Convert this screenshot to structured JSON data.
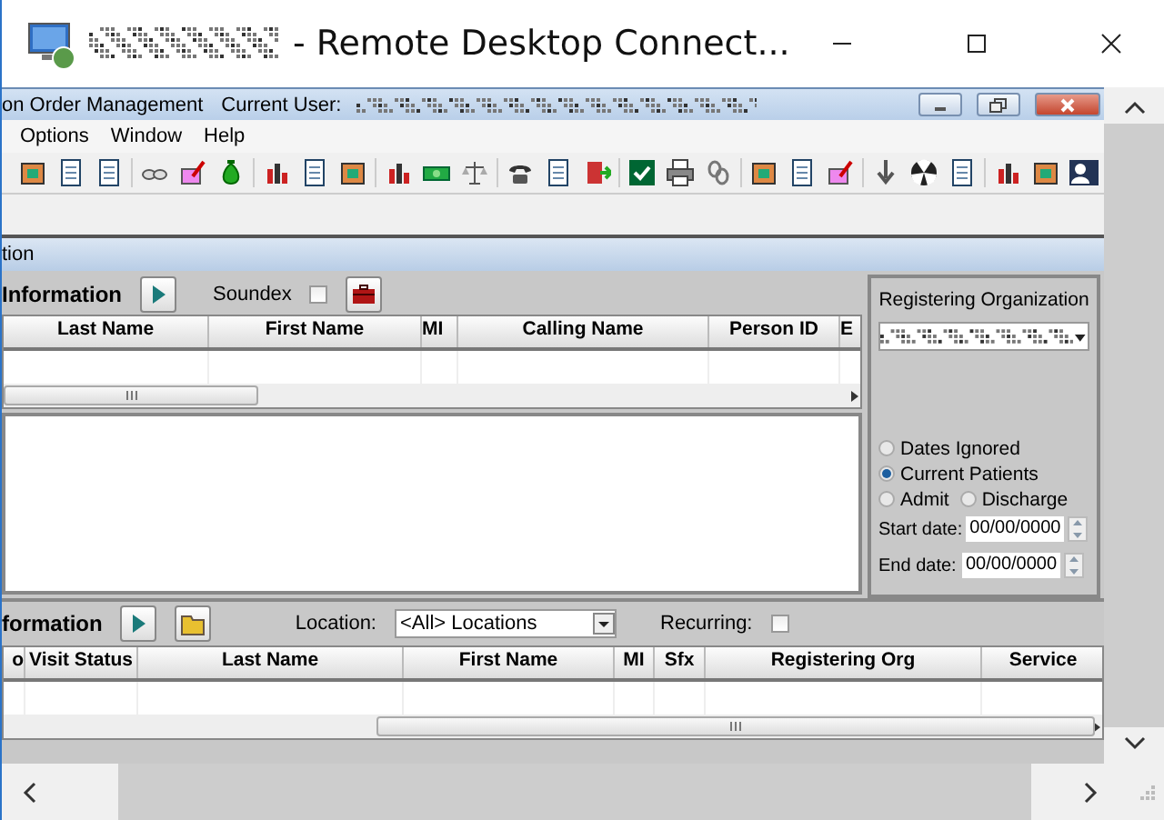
{
  "window": {
    "title": "- Remote Desktop Connect..."
  },
  "app": {
    "title": "on Order Management",
    "user_label": "Current User:"
  },
  "menu": [
    "Options",
    "Window",
    "Help"
  ],
  "toolbar": [
    {
      "kind": "box"
    },
    {
      "kind": "document"
    },
    {
      "kind": "document"
    },
    {
      "kind": "glasses"
    },
    {
      "kind": "pen"
    },
    {
      "kind": "money"
    },
    {
      "kind": "chart"
    },
    {
      "kind": "document"
    },
    {
      "kind": "box"
    },
    {
      "kind": "chart"
    },
    {
      "kind": "cash"
    },
    {
      "kind": "scales"
    },
    {
      "kind": "phone"
    },
    {
      "kind": "document"
    },
    {
      "kind": "door"
    },
    {
      "kind": "check"
    },
    {
      "kind": "printer"
    },
    {
      "kind": "chain"
    },
    {
      "kind": "box"
    },
    {
      "kind": "document"
    },
    {
      "kind": "pen"
    },
    {
      "kind": "arrow"
    },
    {
      "kind": "radiation"
    },
    {
      "kind": "document"
    },
    {
      "kind": "chart"
    },
    {
      "kind": "box"
    },
    {
      "kind": "person"
    }
  ],
  "section_title": "tion",
  "person_search": {
    "title": "Information",
    "soundex": {
      "label": "Soundex",
      "checked": false
    },
    "columns": [
      "Last Name",
      "First Name",
      "MI",
      "Calling Name",
      "Person ID",
      "E"
    ]
  },
  "filter": {
    "title": "Registering Organization",
    "options": [
      {
        "label": "Dates Ignored",
        "selected": false
      },
      {
        "label": "Current Patients",
        "selected": true
      },
      {
        "label": "Admit",
        "selected": false
      },
      {
        "label": "Discharge",
        "selected": false
      }
    ],
    "start_date": {
      "label": "Start date:",
      "value": "00/00/0000"
    },
    "end_date": {
      "label": "End date:",
      "value": "00/00/0000"
    }
  },
  "encounter": {
    "title": "formation",
    "location": {
      "label": "Location:",
      "value": "<All> Locations"
    },
    "recurring": {
      "label": "Recurring:",
      "checked": false
    },
    "columns": [
      "o",
      "Visit Status",
      "Last Name",
      "First Name",
      "MI",
      "Sfx",
      "Registering Org",
      "Service"
    ]
  }
}
